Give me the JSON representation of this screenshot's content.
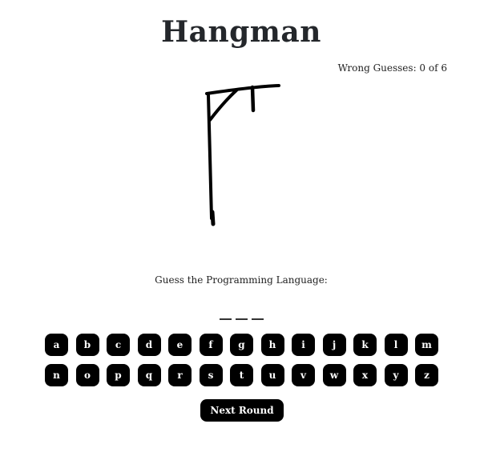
{
  "title": "Hangman",
  "status": {
    "wrong_guesses_text": "Wrong Guesses: 0 of 6",
    "wrong": 0,
    "max": 6
  },
  "prompt": "Guess the Programming Language:",
  "word": {
    "length": 3,
    "slots": [
      "",
      "",
      ""
    ]
  },
  "keyboard": {
    "row1": [
      "a",
      "b",
      "c",
      "d",
      "e",
      "f",
      "g",
      "h",
      "i",
      "j",
      "k",
      "l",
      "m"
    ],
    "row2": [
      "n",
      "o",
      "p",
      "q",
      "r",
      "s",
      "t",
      "u",
      "v",
      "w",
      "x",
      "y",
      "z"
    ]
  },
  "next_round_label": "Next Round",
  "colors": {
    "key_bg": "#000000",
    "key_text": "#ffffff",
    "text": "#24272b"
  }
}
